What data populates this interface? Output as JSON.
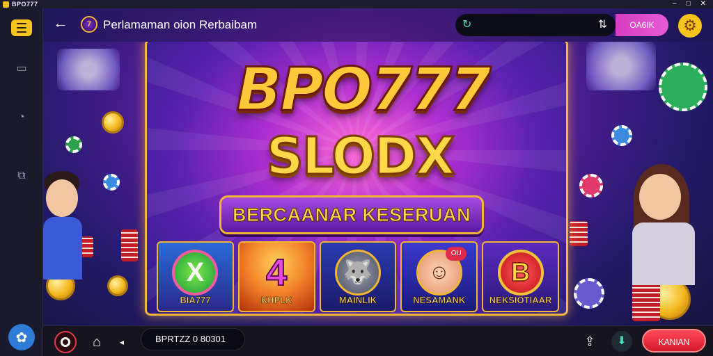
{
  "window": {
    "title": "BPO777"
  },
  "header": {
    "back_label": "←",
    "page_title": "Perlamaman oion Rerbaibam",
    "search": {
      "value": "",
      "placeholder": ""
    },
    "login_label": "OA6IK"
  },
  "banner": {
    "brand_line1": "BPO777",
    "brand_line2": "SLODX",
    "tagline": "BERCAANAR KESERUAN",
    "tiles": [
      {
        "label": "BIA777",
        "art": "X"
      },
      {
        "label": "KHPLK",
        "art": "4"
      },
      {
        "label": "MAINLIK",
        "art": "🐺"
      },
      {
        "label": "NESAMANK",
        "art": "☺",
        "badge": "OU"
      },
      {
        "label": "NEKSIOTIAAR",
        "art": "B"
      }
    ]
  },
  "bottombar": {
    "field_value": "BPRTZZ 0 80301",
    "action_label": "KANIAN"
  },
  "colors": {
    "accent": "#f6c41a",
    "action": "#e2283a",
    "frame": "#f2b634"
  },
  "icons": {
    "sidebar": [
      "menu-icon",
      "chat-icon",
      "history-icon",
      "wallet-icon",
      "support-icon"
    ],
    "header": [
      "back-arrow-icon",
      "search-icon",
      "filter-icon",
      "gear-icon"
    ],
    "bottom": [
      "record-icon",
      "camera-icon",
      "volume-icon",
      "share-icon",
      "download-icon"
    ]
  }
}
